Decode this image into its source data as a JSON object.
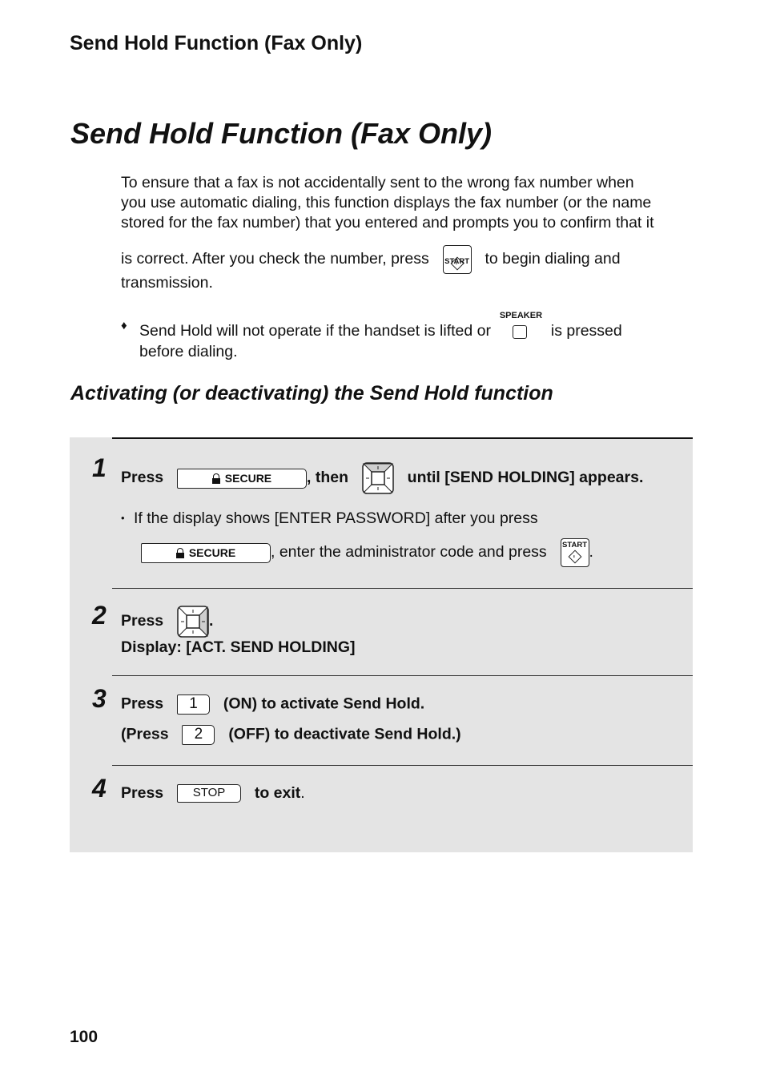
{
  "running_header": "Send Hold Function (Fax Only)",
  "page_title": "Send Hold Function (Fax Only)",
  "intro": {
    "line1": "To ensure that a fax is not accidentally sent to the wrong fax number when",
    "line2": "you use automatic dialing, this function displays the fax number (or the name",
    "line3": "stored for the fax number) that you entered and prompts you to confirm that it",
    "line4_before": "is correct. After you check the number, press",
    "line4_after": "to begin dialing and",
    "line5": "transmission."
  },
  "note": {
    "bullet": "♦",
    "line1_before": "Send Hold will not operate if the handset is lifted or",
    "line1_after": "is pressed",
    "line2": "before dialing."
  },
  "keys": {
    "start": "START",
    "speaker": "SPEAKER",
    "secure": "SECURE",
    "stop": "STOP",
    "one": "1",
    "two": "2"
  },
  "section_heading": "Activating (or deactivating) the Send Hold function",
  "steps": [
    {
      "number": "1",
      "press": "Press",
      "then": ", then",
      "until": "until [SEND HOLDING] appears.",
      "sub_bullet": "•",
      "sub_line1": "If the display shows [ENTER PASSWORD] after you press",
      "sub_line2": ", enter the administrator code and press",
      "sub_end": "."
    },
    {
      "number": "2",
      "press": "Press",
      "end": ".",
      "display": "Display: [ACT. SEND HOLDING]"
    },
    {
      "number": "3",
      "press": "Press",
      "on_text": "(ON) to activate Send Hold.",
      "press_paren": "(Press",
      "off_text": "(OFF) to deactivate Send Hold.)"
    },
    {
      "number": "4",
      "press": "Press",
      "exit_text": "to exit",
      "end": "."
    }
  ],
  "page_number": "100"
}
